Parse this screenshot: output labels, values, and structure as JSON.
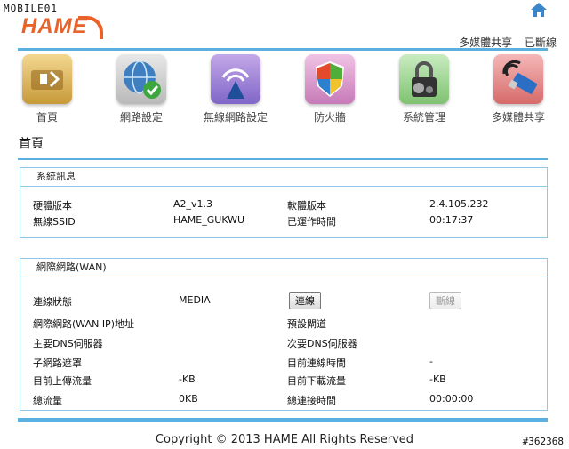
{
  "brand": {
    "watermark": "MOBILE01",
    "logo": "HAME"
  },
  "top_links": {
    "media_share": "多媒體共享",
    "connected": "已斷線"
  },
  "nav": [
    {
      "label": "首頁",
      "icon": "home-speaker-icon"
    },
    {
      "label": "網路設定",
      "icon": "network-globe-icon"
    },
    {
      "label": "無線網路設定",
      "icon": "wireless-icon"
    },
    {
      "label": "防火牆",
      "icon": "firewall-shield-icon"
    },
    {
      "label": "系統管理",
      "icon": "system-lock-icon"
    },
    {
      "label": "多媒體共享",
      "icon": "usb-media-icon"
    }
  ],
  "page_title": "首頁",
  "system_info": {
    "title": "系統訊息",
    "hw_label": "硬體版本",
    "hw_value": "A2_v1.3",
    "sw_label": "軟體版本",
    "sw_value": "2.4.105.232",
    "ssid_label": "無線SSID",
    "ssid_value": "HAME_GUKWU",
    "uptime_label": "已運作時間",
    "uptime_value": "00:17:37"
  },
  "wan": {
    "title": "網際網路(WAN)",
    "status_label": "連線狀態",
    "status_value": "MEDIA",
    "connect_button": "連線",
    "disconnect_button": "斷線",
    "ip_label": "網際網路(WAN IP)地址",
    "gateway_label": "預設閘道",
    "dns1_label": "主要DNS伺服器",
    "dns2_label": "次要DNS伺服器",
    "subnet_label": "子網路遮罩",
    "conn_time_label": "目前連線時間",
    "conn_time_value": "-",
    "up_label": "目前上傳流量",
    "up_value": "-KB",
    "down_label": "目前下載流量",
    "down_value": "-KB",
    "total_label": "總流量",
    "total_value": "0KB",
    "total_time_label": "總連接時間",
    "total_time_value": "00:00:00"
  },
  "footer": "Copyright © 2013 HAME All Rights Reserved",
  "tag": "#362368"
}
